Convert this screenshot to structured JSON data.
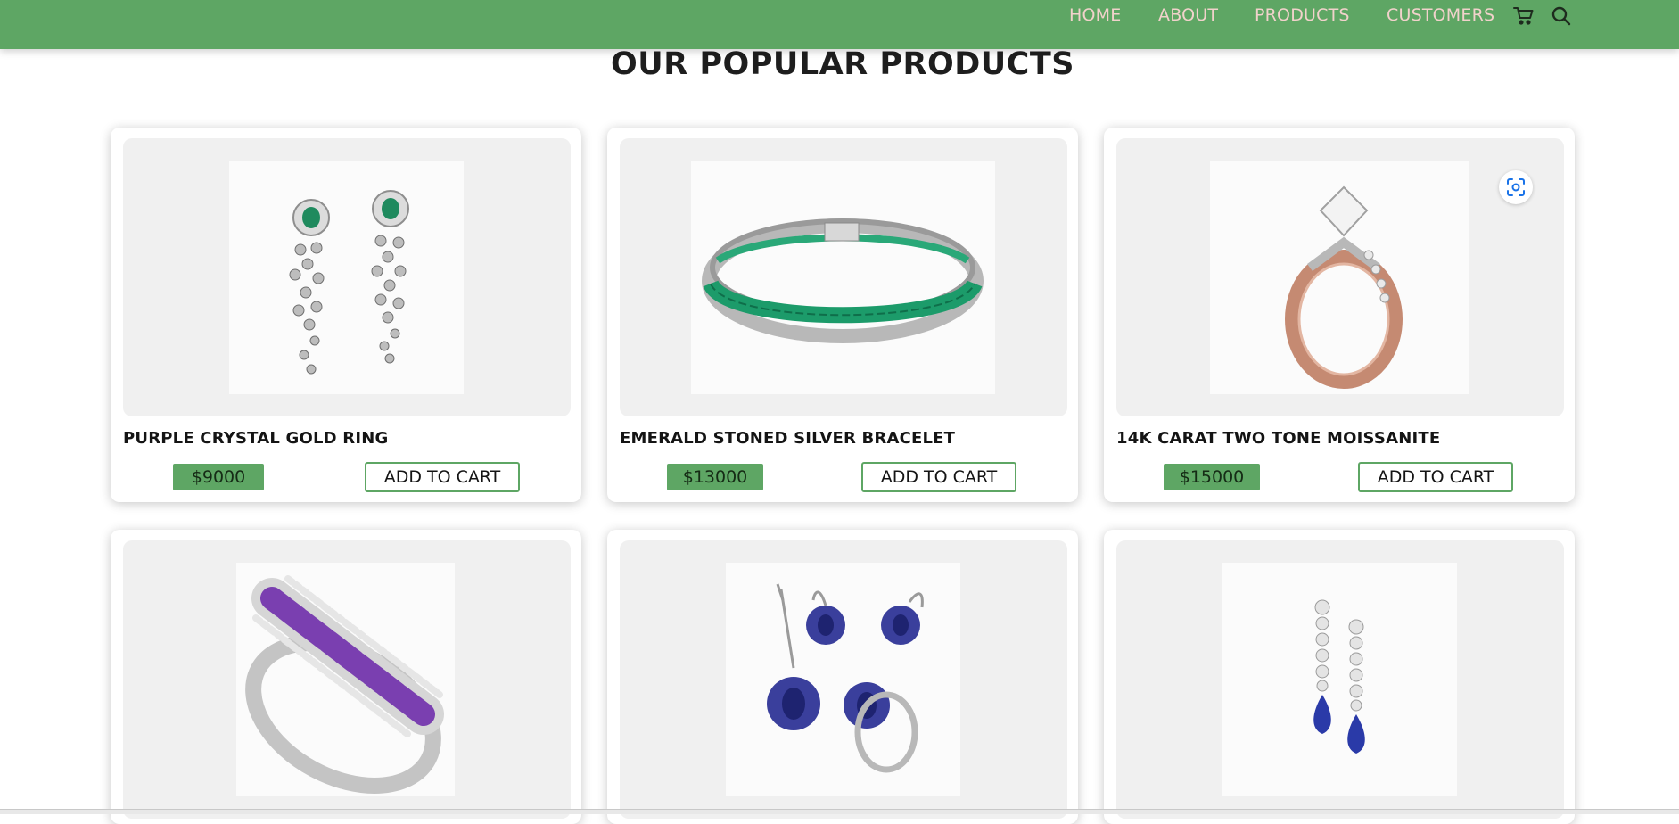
{
  "nav": {
    "links": [
      "HOME",
      "ABOUT",
      "PRODUCTS",
      "CUSTOMERS"
    ],
    "icons": [
      "cart-icon",
      "search-icon"
    ]
  },
  "page": {
    "title": "OUR POPULAR PRODUCTS"
  },
  "products": [
    {
      "name": "PURPLE CRYSTAL GOLD RING",
      "price": "$9000",
      "button": "ADD TO CART",
      "image": "emerald-drop-earrings"
    },
    {
      "name": "EMERALD STONED SILVER BRACELET",
      "price": "$13000",
      "button": "ADD TO CART",
      "image": "emerald-silver-bracelet"
    },
    {
      "name": "14K CARAT TWO TONE MOISSANITE",
      "price": "$15000",
      "button": "ADD TO CART",
      "image": "two-tone-moissanite-ring"
    },
    {
      "name": "",
      "price": "",
      "button": "",
      "image": "amethyst-band-ring"
    },
    {
      "name": "",
      "price": "",
      "button": "",
      "image": "sapphire-jewelry-set"
    },
    {
      "name": "",
      "price": "",
      "button": "",
      "image": "sapphire-drop-earrings"
    }
  ],
  "colors": {
    "accent": "#5ea664",
    "nav_text": "#f1d2cb",
    "card_image_bg": "#f0f0f0"
  }
}
